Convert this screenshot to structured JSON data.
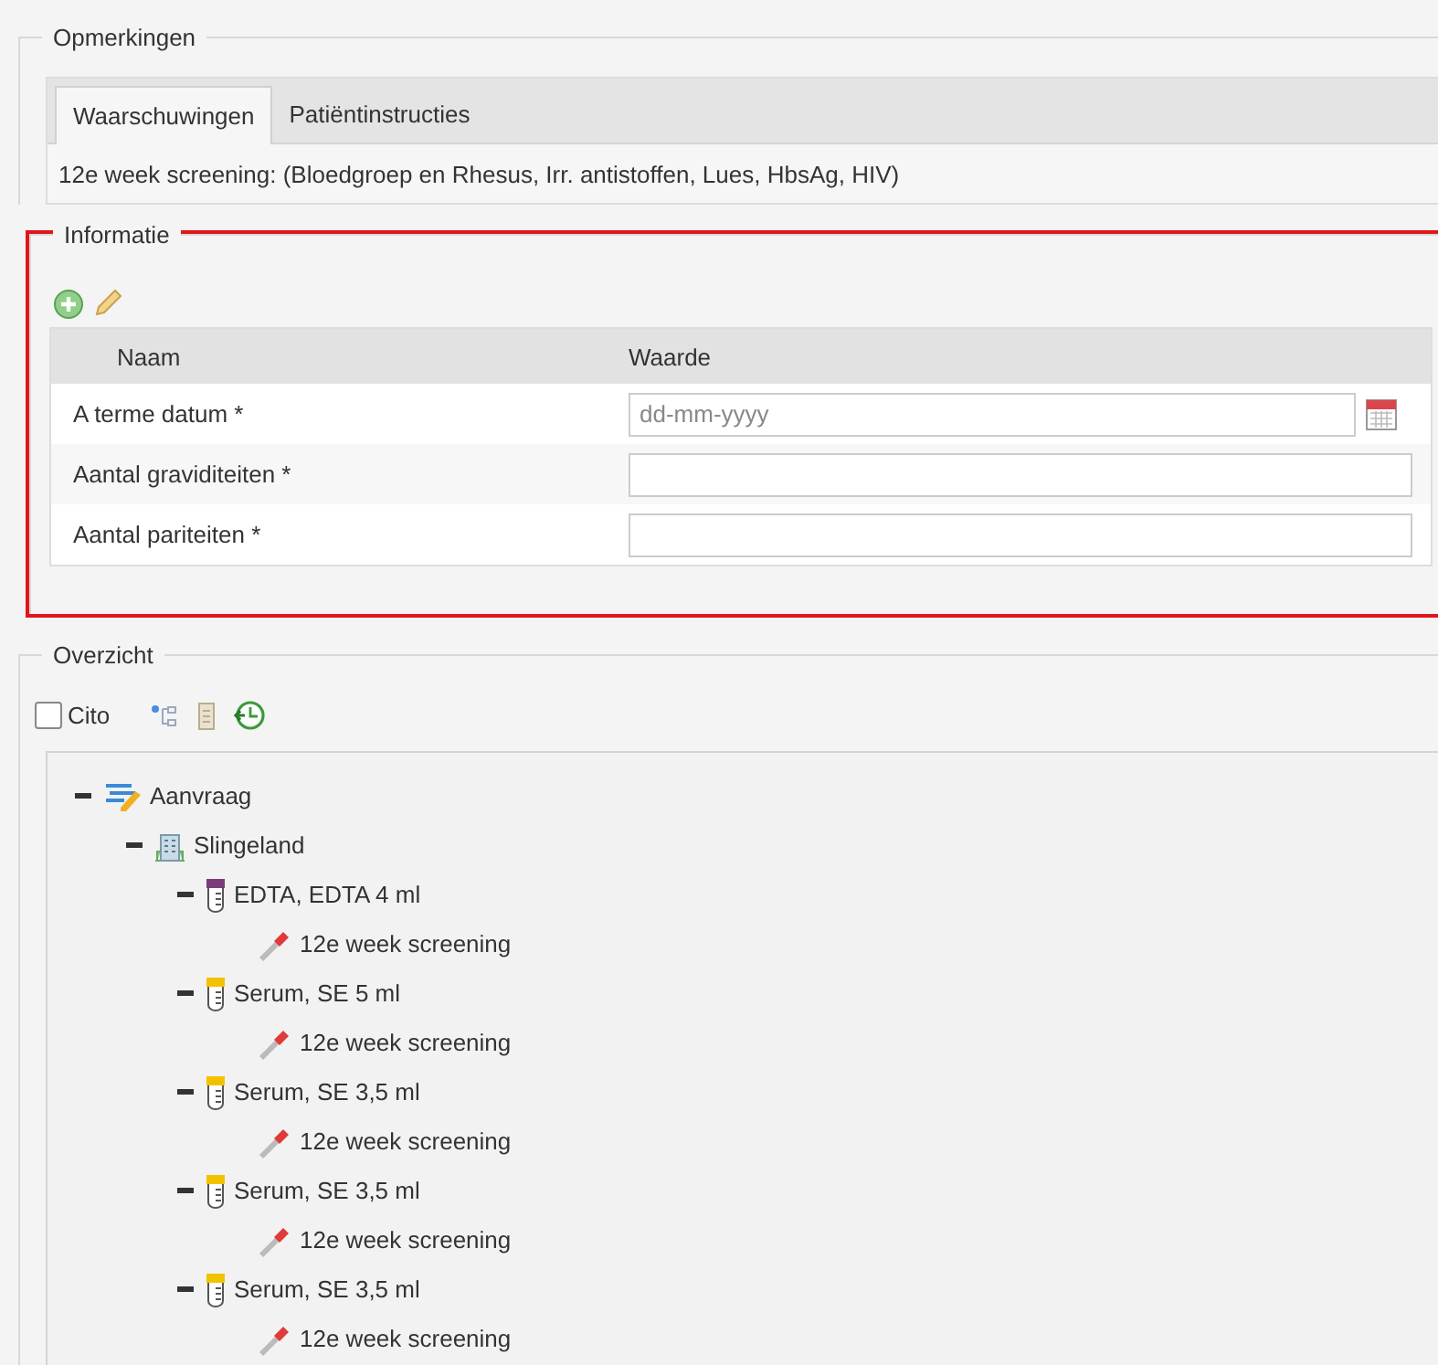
{
  "opmerkingen": {
    "legend": "Opmerkingen",
    "tabs": [
      {
        "label": "Waarschuwingen",
        "selected": true
      },
      {
        "label": "Patiëntinstructies",
        "selected": false
      }
    ],
    "content": "12e week screening: (Bloedgroep en Rhesus, Irr. antistoffen, Lues, HbsAg, HIV)"
  },
  "informatie": {
    "legend": "Informatie",
    "highlighted": true,
    "columns": [
      "Naam",
      "Waarde"
    ],
    "rows": [
      {
        "name": "A terme datum *",
        "kind": "date",
        "placeholder": "dd-mm-yyyy"
      },
      {
        "name": "Aantal graviditeiten *",
        "kind": "text"
      },
      {
        "name": "Aantal pariteiten *",
        "kind": "text"
      }
    ]
  },
  "overzicht": {
    "legend": "Overzicht",
    "cito": {
      "label": "Cito",
      "checked": false
    },
    "tree": [
      {
        "kind": "request",
        "label": "Aanvraag",
        "expanded": true,
        "children": [
          {
            "kind": "location",
            "label": "Slingeland",
            "expanded": true,
            "children": [
              {
                "kind": "tube",
                "label": "EDTA, EDTA 4 ml",
                "color": "#7a3b7a",
                "expanded": true,
                "children": [
                  {
                    "kind": "test",
                    "label": "12e week screening"
                  }
                ]
              },
              {
                "kind": "tube",
                "label": "Serum, SE 5 ml",
                "color": "#f2c200",
                "expanded": true,
                "children": [
                  {
                    "kind": "test",
                    "label": "12e week screening"
                  }
                ]
              },
              {
                "kind": "tube",
                "label": "Serum, SE 3,5 ml",
                "color": "#f2c200",
                "expanded": true,
                "children": [
                  {
                    "kind": "test",
                    "label": "12e week screening"
                  }
                ]
              },
              {
                "kind": "tube",
                "label": "Serum, SE 3,5 ml",
                "color": "#f2c200",
                "expanded": true,
                "children": [
                  {
                    "kind": "test",
                    "label": "12e week screening"
                  }
                ]
              },
              {
                "kind": "tube",
                "label": "Serum, SE 3,5 ml",
                "color": "#f2c200",
                "expanded": true,
                "children": [
                  {
                    "kind": "test",
                    "label": "12e week screening"
                  }
                ]
              }
            ]
          }
        ]
      }
    ]
  }
}
